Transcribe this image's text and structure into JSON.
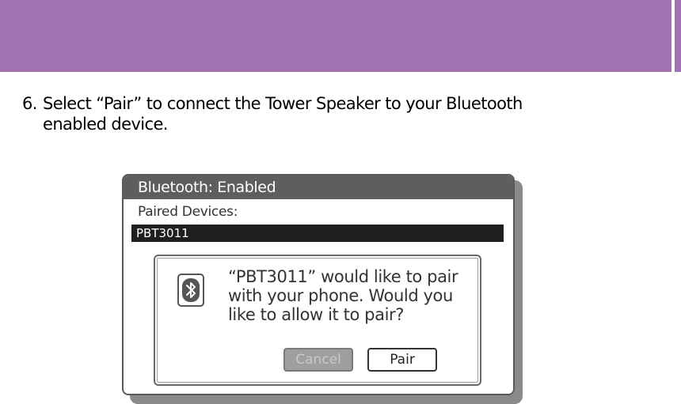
{
  "colors": {
    "header_band": "#a173b1",
    "titlebar": "#5e5e5e",
    "selected_row": "#1f1f1f",
    "cancel_button": "#9f9f9f"
  },
  "instruction": {
    "number": "6.",
    "line1": "Select “Pair” to connect the Tower Speaker to your Bluetooth",
    "line2": "enabled device."
  },
  "dialog": {
    "title": "Bluetooth: Enabled",
    "section_label": "Paired Devices:",
    "selected_device": "PBT3011",
    "prompt": {
      "icon": "bluetooth-icon",
      "message": "“PBT3011” would like to pair with your phone. Would you like to allow it to pair?",
      "cancel_label": "Cancel",
      "pair_label": "Pair"
    }
  }
}
